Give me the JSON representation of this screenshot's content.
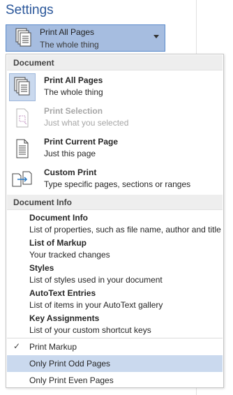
{
  "settings": {
    "title": "Settings"
  },
  "selector": {
    "title": "Print All Pages",
    "subtitle": "The whole thing"
  },
  "menu": {
    "document_header": "Document",
    "document_items": [
      {
        "title": "Print All Pages",
        "subtitle": "The whole thing",
        "icon": "pages-stack-icon",
        "selected": true,
        "enabled": true
      },
      {
        "title": "Print Selection",
        "subtitle": "Just what you selected",
        "icon": "selection-page-icon",
        "selected": false,
        "enabled": false
      },
      {
        "title": "Print Current Page",
        "subtitle": "Just this page",
        "icon": "single-page-icon",
        "selected": false,
        "enabled": true
      },
      {
        "title": "Custom Print",
        "subtitle": "Type specific pages, sections or ranges",
        "icon": "custom-print-icon",
        "selected": false,
        "enabled": true
      }
    ],
    "document_info_header": "Document Info",
    "info_items": [
      {
        "title": "Document Info",
        "subtitle": "List of properties, such as file name, author and title"
      },
      {
        "title": "List of Markup",
        "subtitle": "Your tracked changes"
      },
      {
        "title": "Styles",
        "subtitle": "List of styles used in your document"
      },
      {
        "title": "AutoText Entries",
        "subtitle": "List of items in your AutoText gallery"
      },
      {
        "title": "Key Assignments",
        "subtitle": "List of your custom shortcut keys"
      }
    ],
    "options": [
      {
        "label": "Print Markup",
        "checked": true
      },
      {
        "label": "Only Print Odd Pages",
        "checked": false,
        "hover": true
      },
      {
        "label": "Only Print Even Pages",
        "checked": false
      }
    ],
    "check_glyph": "✓"
  },
  "colors": {
    "accent": "#2b579a",
    "selection": "#cad9ee",
    "selector_bg": "#a6bde0"
  }
}
